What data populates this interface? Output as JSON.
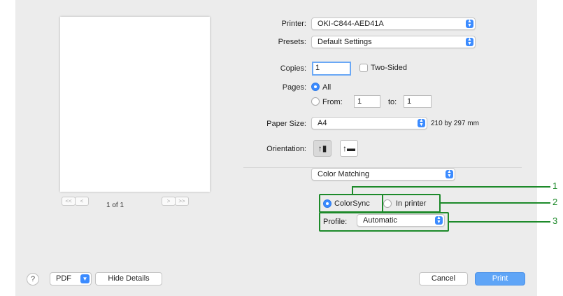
{
  "preview": {
    "page_count": "1 of 1",
    "nav_first": "<<",
    "nav_prev": "<",
    "nav_next": ">",
    "nav_last": ">>"
  },
  "printer": {
    "label": "Printer:",
    "value": "OKI-C844-AED41A"
  },
  "presets": {
    "label": "Presets:",
    "value": "Default Settings"
  },
  "copies": {
    "label": "Copies:",
    "value": "1",
    "two_sided_label": "Two-Sided"
  },
  "pages": {
    "label": "Pages:",
    "all_label": "All",
    "from_label": "From:",
    "from_value": "1",
    "to_label": "to:",
    "to_value": "1"
  },
  "paper_size": {
    "label": "Paper Size:",
    "value": "A4",
    "dimensions": "210 by 297 mm"
  },
  "orientation": {
    "label": "Orientation:",
    "portrait_glyph": "↑▮",
    "landscape_glyph": "↑▬"
  },
  "section": {
    "value": "Color Matching"
  },
  "color_matching": {
    "colorsync_label": "ColorSync",
    "in_printer_label": "In printer",
    "profile_label": "Profile:",
    "profile_value": "Automatic"
  },
  "callouts": [
    "1",
    "2",
    "3"
  ],
  "footer": {
    "help_label": "?",
    "pdf_label": "PDF",
    "hide_details_label": "Hide Details",
    "cancel_label": "Cancel",
    "print_label": "Print"
  },
  "colors": {
    "accent": "#3b8bff",
    "callout": "#1d8a2a",
    "dialog_bg": "#ececec"
  },
  "icons": {
    "popup": "popup-stepper-icon",
    "chevron": "chevron-down-icon",
    "help": "help-icon"
  }
}
